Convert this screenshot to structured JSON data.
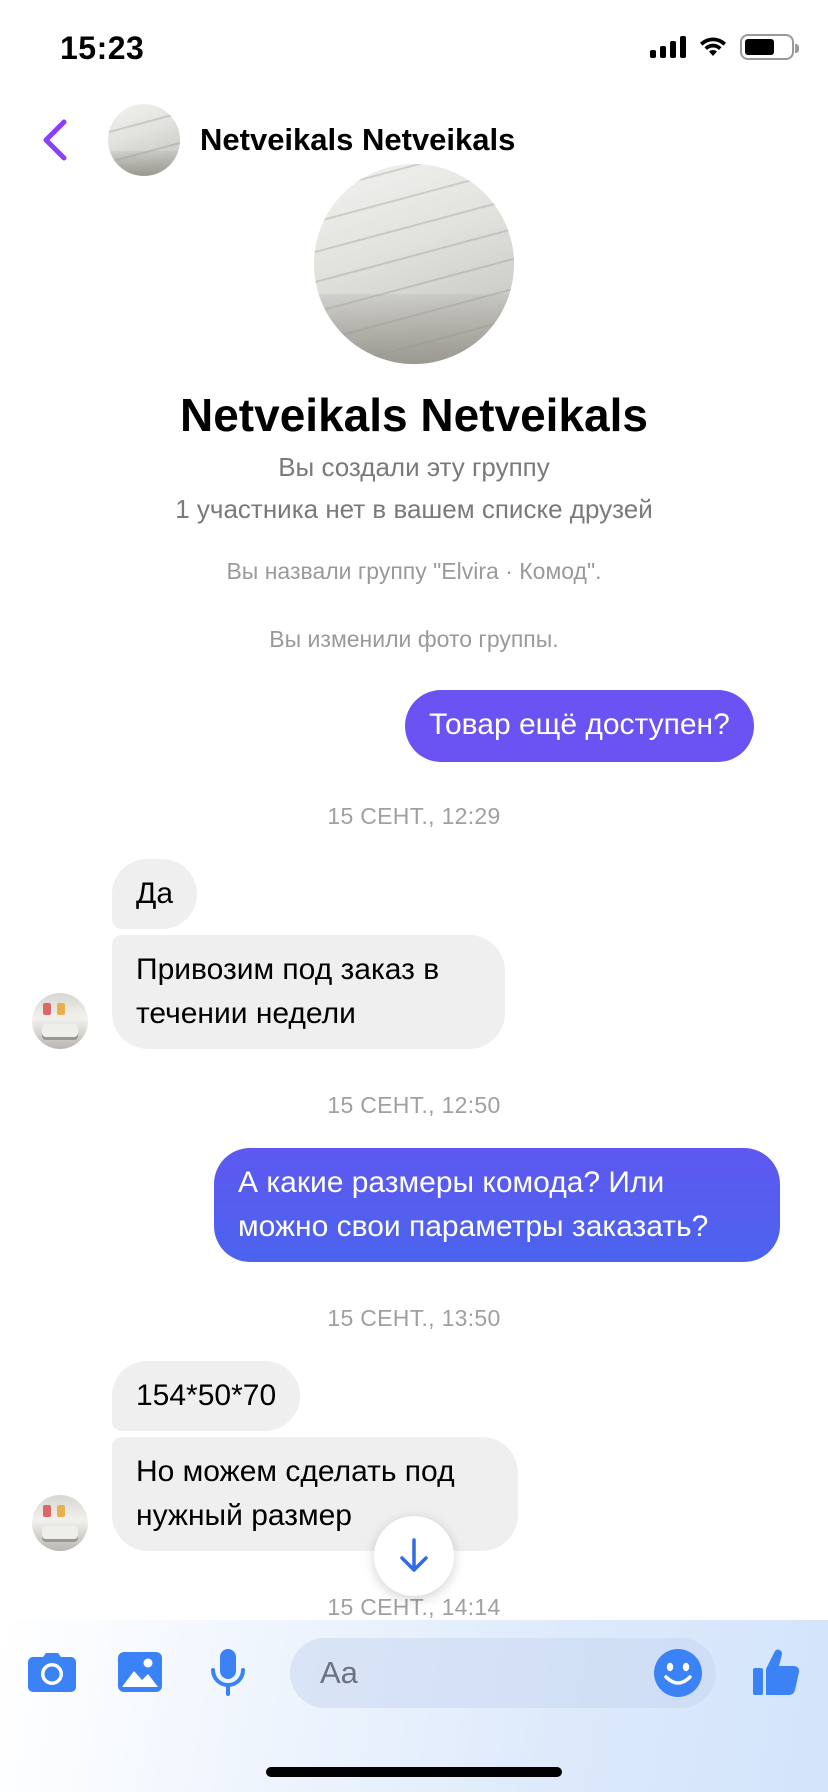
{
  "status_bar": {
    "time": "15:23",
    "battery_level": 0.65
  },
  "header": {
    "title": "Netveikals Netveikals"
  },
  "group_info": {
    "name": "Netveikals Netveikals",
    "created_note": "Вы создали эту группу",
    "friends_note": "1 участника нет в вашем списке друзей"
  },
  "system_messages": [
    "Вы назвали группу \"Elvira · Комод\".",
    "Вы изменили фото группы."
  ],
  "messages": [
    {
      "direction": "out",
      "text": "Товар ещё доступен?"
    },
    {
      "type": "timestamp",
      "text": "15 СЕНТ., 12:29"
    },
    {
      "direction": "in",
      "text": "Да"
    },
    {
      "direction": "in",
      "lines": [
        "Привозим под заказ в",
        "течении недели"
      ]
    },
    {
      "type": "timestamp",
      "text": "15 СЕНТ., 12:50"
    },
    {
      "direction": "out",
      "lines": [
        "А какие размеры комода? Или",
        "можно свои параметры заказать?"
      ]
    },
    {
      "type": "timestamp",
      "text": "15 СЕНТ., 13:50"
    },
    {
      "direction": "in",
      "text": "154*50*70"
    },
    {
      "direction": "in",
      "lines": [
        "Но можем сделать под",
        "нужный размер"
      ]
    },
    {
      "type": "timestamp",
      "text": "15 СЕНТ., 14:14"
    }
  ],
  "composer": {
    "placeholder": "Aa",
    "icons": [
      "camera-icon",
      "gallery-icon",
      "microphone-icon",
      "emoji-icon",
      "thumbs-up-icon"
    ]
  },
  "colors": {
    "accent": "#8a3ffc",
    "outgoing_top": "#6b52f2",
    "outgoing_bottom": "#4b63ee",
    "incoming": "#efefef",
    "composer_icon": "#3b82f6"
  }
}
